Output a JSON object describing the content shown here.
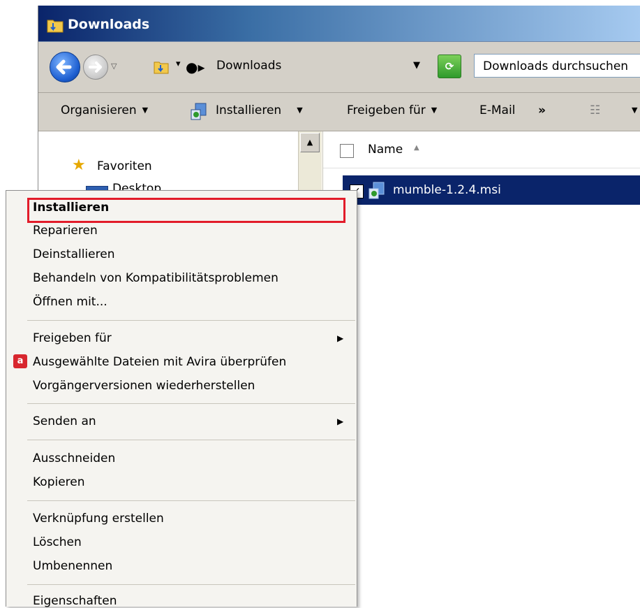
{
  "window": {
    "title": "Downloads"
  },
  "address_bar": {
    "path": "Downloads",
    "search_placeholder": "Downloads durchsuchen"
  },
  "toolbar": {
    "organize": "Organisieren",
    "install": "Installieren",
    "share": "Freigeben für",
    "email": "E-Mail",
    "more": "»"
  },
  "nav_pane": {
    "favorites": "Favoriten",
    "desktop": "Desktop"
  },
  "file_list": {
    "column_name": "Name",
    "files": [
      {
        "name": "mumble-1.2.4.msi",
        "checked": true,
        "selected": true
      }
    ]
  },
  "context_menu": {
    "items": [
      {
        "label": "Installieren",
        "bold": true,
        "highlighted": true
      },
      {
        "label": "Reparieren"
      },
      {
        "label": "Deinstallieren"
      },
      {
        "label": "Behandeln von Kompatibilitätsproblemen"
      },
      {
        "label": "Öffnen mit..."
      },
      {
        "label": "Freigeben für",
        "submenu": true
      },
      {
        "label": "Ausgewählte Dateien mit Avira überprüfen",
        "icon": "avira-icon"
      },
      {
        "label": "Vorgängerversionen wiederherstellen"
      },
      {
        "label": "Senden an",
        "submenu": true
      },
      {
        "label": "Ausschneiden"
      },
      {
        "label": "Kopieren"
      },
      {
        "label": "Verknüpfung erstellen"
      },
      {
        "label": "Löschen"
      },
      {
        "label": "Umbenennen"
      },
      {
        "label": "Eigenschaften"
      }
    ]
  },
  "colors": {
    "highlight_box": "#e21c2a",
    "selection": "#0a246a"
  }
}
